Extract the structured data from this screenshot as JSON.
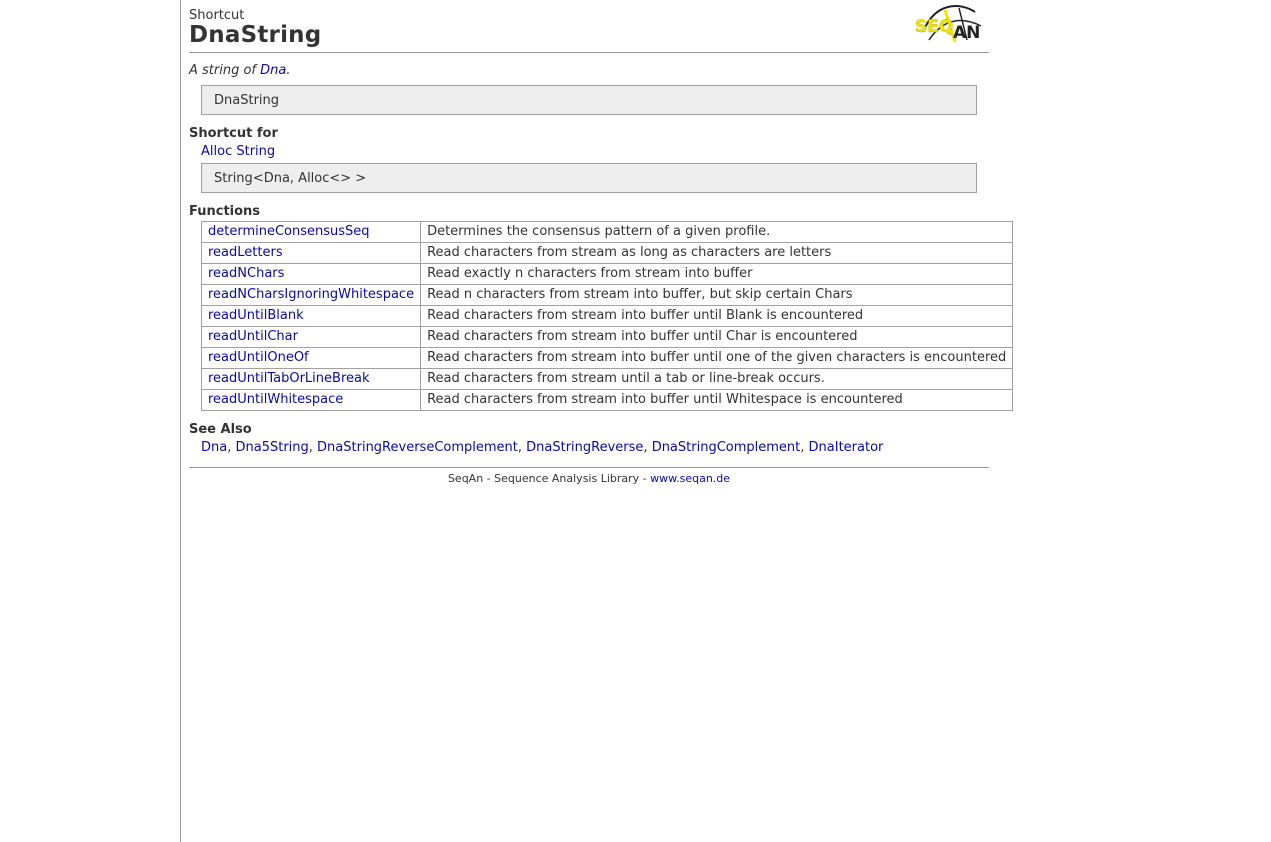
{
  "header": {
    "kind": "Shortcut",
    "title": "DnaString",
    "logo_text": "SEQAN"
  },
  "summary": {
    "prefix": "A string of ",
    "link": "Dna",
    "suffix": "."
  },
  "signature": "DnaString",
  "shortcut_for": {
    "heading": "Shortcut for",
    "link": "Alloc String",
    "code": "String<Dna, Alloc<> >"
  },
  "functions": {
    "heading": "Functions",
    "rows": [
      {
        "name": "determineConsensusSeq",
        "desc": "Determines the consensus pattern of a given profile."
      },
      {
        "name": "readLetters",
        "desc": "Read characters from stream as long as characters are letters"
      },
      {
        "name": "readNChars",
        "desc": "Read exactly n characters from stream into buffer"
      },
      {
        "name": "readNCharsIgnoringWhitespace",
        "desc": "Read n characters from stream into buffer, but skip certain Chars"
      },
      {
        "name": "readUntilBlank",
        "desc": "Read characters from stream into buffer until Blank is encountered"
      },
      {
        "name": "readUntilChar",
        "desc": "Read characters from stream into buffer until Char is encountered"
      },
      {
        "name": "readUntilOneOf",
        "desc": "Read characters from stream into buffer until one of the given characters is encountered"
      },
      {
        "name": "readUntilTabOrLineBreak",
        "desc": "Read characters from stream until a tab or line-break occurs."
      },
      {
        "name": "readUntilWhitespace",
        "desc": "Read characters from stream into buffer until Whitespace is encountered"
      }
    ]
  },
  "see_also": {
    "heading": "See Also",
    "links": [
      "Dna",
      "Dna5String",
      "DnaStringReverseComplement",
      "DnaStringReverse",
      "DnaStringComplement",
      "DnaIterator"
    ]
  },
  "footer": {
    "text": "SeqAn - Sequence Analysis Library - ",
    "link": "www.seqan.de"
  },
  "colors": {
    "link": "#0a0aa0",
    "codebox_bg": "#eeeeee",
    "logo_yellow": "#f2e600"
  }
}
